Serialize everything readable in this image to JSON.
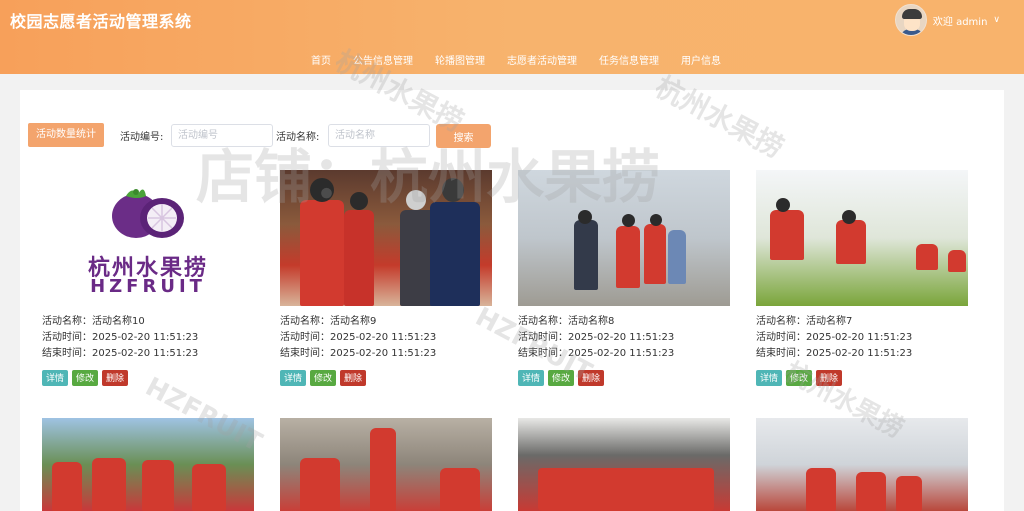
{
  "header": {
    "title": "校园志愿者活动管理系统",
    "nav": [
      "首页",
      "公告信息管理",
      "轮播图管理",
      "志愿者活动管理",
      "任务信息管理",
      "用户信息"
    ],
    "welcome": "欢迎 admin",
    "chevron": "∨"
  },
  "toolbar": {
    "stat_label": "活动数量统计",
    "code_label": "活动编号:",
    "code_placeholder": "活动编号",
    "name_label": "活动名称:",
    "name_placeholder": "活动名称",
    "search_label": "搜索"
  },
  "logo": {
    "cn": "杭州水果捞",
    "en": "HZFRUIT"
  },
  "watermark": {
    "store": "店铺：杭州水果捞",
    "cn": "杭州水果捞",
    "en": "HZFRUIT"
  },
  "buttons": {
    "detail": "详情",
    "edit": "修改",
    "delete": "删除"
  },
  "cards": [
    {
      "name": "活动名称：活动名称10",
      "time": "活动时间：2025-02-20 11:51:23",
      "end": "结束时间：2025-02-20 11:51:23"
    },
    {
      "name": "活动名称：活动名称9",
      "time": "活动时间：2025-02-20 11:51:23",
      "end": "结束时间：2025-02-20 11:51:23"
    },
    {
      "name": "活动名称：活动名称8",
      "time": "活动时间：2025-02-20 11:51:23",
      "end": "结束时间：2025-02-20 11:51:23"
    },
    {
      "name": "活动名称：活动名称7",
      "time": "活动时间：2025-02-20 11:51:23",
      "end": "结束时间：2025-02-20 11:51:23"
    }
  ],
  "colors": {
    "header_start": "#f7a05a",
    "header_end": "#f8b36c",
    "accent": "#f3a46d",
    "brand_purple": "#6a2a86"
  }
}
